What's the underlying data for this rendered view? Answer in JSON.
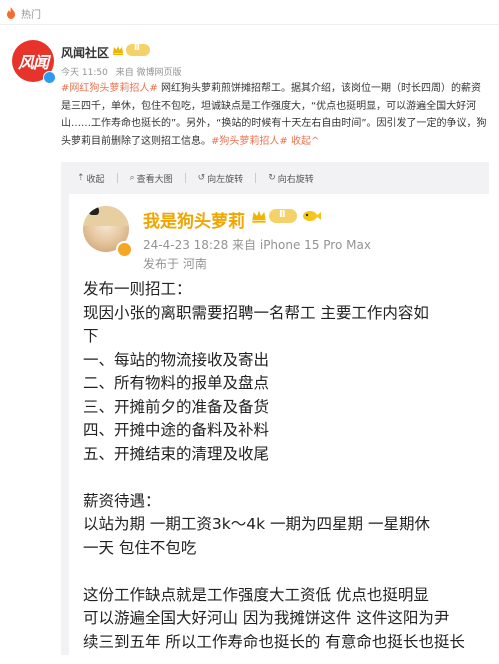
{
  "top": {
    "tag": "热门"
  },
  "post": {
    "user": "风闻社区",
    "avatar_text": "风闻",
    "level": "Ⅱ",
    "time": "今天 11:50",
    "source": "来自 微博网页版",
    "text": {
      "hashtag1": "#网红狗头萝莉招人#",
      "body": " 网红狗头萝莉煎饼摊招帮工。据其介绍，该岗位一期（时长四周）的薪资是三四千，单休，包住不包吃，坦诚缺点是工作强度大，“优点也挺明显，可以游遍全国大好河山……工作寿命也挺长的”。另外，“换站的时候有十天左右自由时间”。因引发了一定的争议，狗头萝莉目前删除了这则招工信息。",
      "hashtag2": "#狗头萝莉招人#",
      "collapse": " 收起^"
    }
  },
  "toolbar": {
    "collapse": "收起",
    "view_large": "查看大图",
    "rotate_left": "向左旋转",
    "rotate_right": "向右旋转"
  },
  "screenshot": {
    "name": "我是狗头萝莉",
    "level": "Ⅱ",
    "meta": "24-4-23 18:28  来自 iPhone 15 Pro Max",
    "location": "发布于 河南",
    "lines": [
      "发布一则招工：",
      "现因小张的离职需要招聘一名帮工 主要工作内容如",
      "下",
      "一、每站的物流接收及寄出",
      "二、所有物料的报单及盘点",
      "三、开摊前夕的准备及备货",
      "四、开摊中途的备料及补料",
      "五、开摊结束的清理及收尾",
      "",
      "薪资待遇：",
      "以站为期 一期工资3k～4k 一期为四星期 一星期休",
      "一天 包住不包吃",
      "",
      "这份工作缺点就是工作强度大工资低 优点也挺明显",
      "可以游遍全国大好河山 因为我摊饼这件 这件这阳为尹",
      "续三到五年 所以工作寿命也挺长的 有意命也挺长也挺长"
    ]
  },
  "colors": {
    "accent": "#eb7350",
    "gold": "#f0a500",
    "brand": "#e7332a"
  },
  "icons": [
    "flame-icon",
    "crown-icon",
    "verified-icon",
    "collapse-icon",
    "zoom-icon",
    "rotate-left-icon",
    "rotate-right-icon",
    "fish-icon"
  ]
}
